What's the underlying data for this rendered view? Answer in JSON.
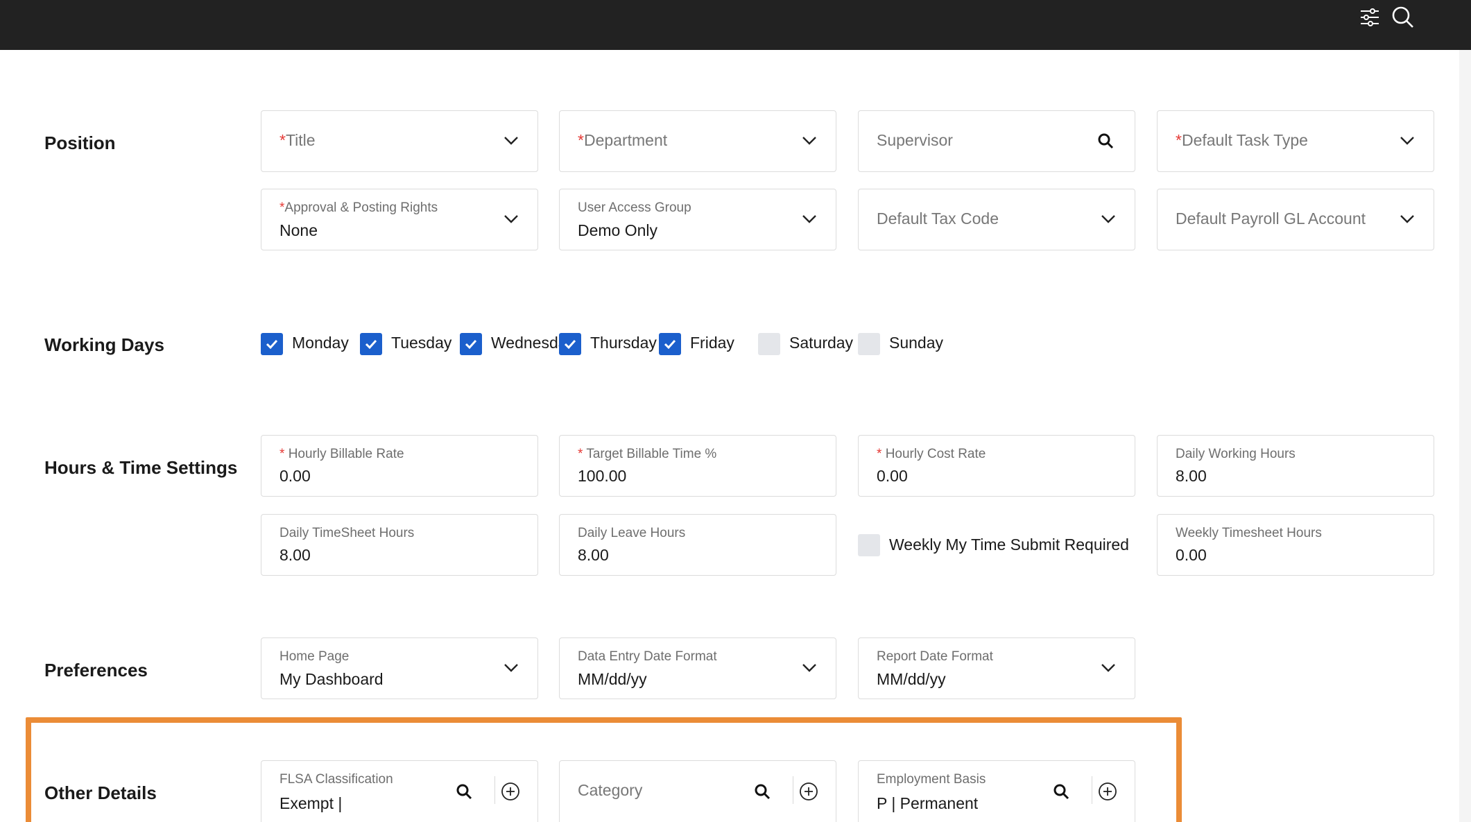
{
  "topbar": {
    "icons": [
      "filter-sliders-icon",
      "search-icon"
    ]
  },
  "sections": {
    "position": "Position",
    "working_days": "Working Days",
    "hours": "Hours & Time Settings",
    "preferences": "Preferences",
    "other": "Other Details"
  },
  "position": {
    "title": {
      "req": "*",
      "placeholder": "Title"
    },
    "department": {
      "req": "*",
      "placeholder": "Department"
    },
    "supervisor": {
      "placeholder": "Supervisor"
    },
    "default_task_type": {
      "req": "*",
      "placeholder": "Default Task Type"
    },
    "approval": {
      "req": "*",
      "label": "Approval & Posting Rights",
      "value": "None"
    },
    "user_access_group": {
      "label": "User Access Group",
      "value": "Demo Only"
    },
    "default_tax_code": {
      "placeholder": "Default Tax Code"
    },
    "default_payroll_gl": {
      "placeholder": "Default Payroll GL Account"
    }
  },
  "working_days": [
    {
      "label": "Monday",
      "checked": true
    },
    {
      "label": "Tuesday",
      "checked": true
    },
    {
      "label": "Wednesday",
      "checked": true
    },
    {
      "label": "Thursday",
      "checked": true
    },
    {
      "label": "Friday",
      "checked": true
    },
    {
      "label": "Saturday",
      "checked": false
    },
    {
      "label": "Sunday",
      "checked": false
    }
  ],
  "hours": {
    "hourly_billable_rate": {
      "req": "*",
      "label": "Hourly Billable Rate",
      "value": "0.00"
    },
    "target_billable_time": {
      "req": "*",
      "label": "Target Billable Time %",
      "value": "100.00"
    },
    "hourly_cost_rate": {
      "req": "*",
      "label": "Hourly Cost Rate",
      "value": "0.00"
    },
    "daily_working_hours": {
      "label": "Daily Working Hours",
      "value": "8.00"
    },
    "daily_timesheet_hours": {
      "label": "Daily TimeSheet Hours",
      "value": "8.00"
    },
    "daily_leave_hours": {
      "label": "Daily Leave Hours",
      "value": "8.00"
    },
    "weekly_submit_required": {
      "label": "Weekly My Time Submit Required",
      "checked": false
    },
    "weekly_timesheet_hours": {
      "label": "Weekly Timesheet Hours",
      "value": "0.00"
    }
  },
  "preferences": {
    "home_page": {
      "label": "Home Page",
      "value": "My Dashboard"
    },
    "data_entry_date_format": {
      "label": "Data Entry Date Format",
      "value": "MM/dd/yy"
    },
    "report_date_format": {
      "label": "Report Date Format",
      "value": "MM/dd/yy"
    }
  },
  "other": {
    "flsa": {
      "label": "FLSA Classification",
      "value": "Exempt |"
    },
    "category": {
      "placeholder": "Category"
    },
    "employment_basis": {
      "label": "Employment Basis",
      "value": "P | Permanent"
    }
  },
  "colors": {
    "topbar": "#222222",
    "checkbox_on": "#1b5fcc",
    "highlight": "#eb8c37",
    "required": "#e53935"
  }
}
